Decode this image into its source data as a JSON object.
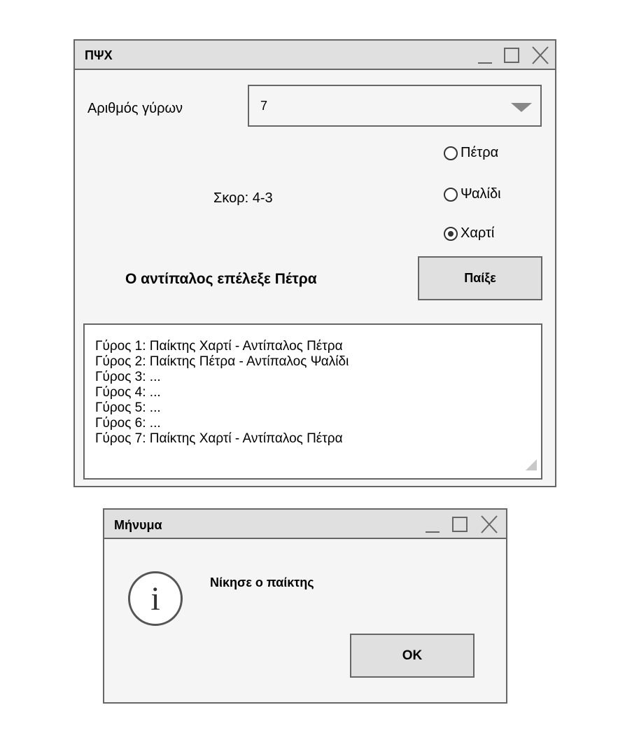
{
  "main_window": {
    "title": "ΠΨΧ",
    "rounds_label": "Αριθμός γύρων",
    "rounds_value": "7",
    "score_text": "Σκορ: 4-3",
    "radios": [
      {
        "label": "Πέτρα",
        "checked": false
      },
      {
        "label": "Ψαλίδι",
        "checked": false
      },
      {
        "label": "Χαρτί",
        "checked": true
      }
    ],
    "opponent_text": "Ο αντίπαλος επέλεξε Πέτρα",
    "play_label": "Παίξε",
    "log": [
      "Γύρος 1: Παίκτης Χαρτί - Αντίπαλος Πέτρα",
      "Γύρος 2: Παίκτης Πέτρα - Αντίπαλος Ψαλίδι",
      "Γύρος 3: ...",
      "Γύρος 4: ...",
      "Γύρος 5: ...",
      "Γύρος 6: ...",
      "Γύρος 7: Παίκτης Χαρτί - Αντίπαλος Πέτρα"
    ]
  },
  "message_window": {
    "title": "Μήνυμα",
    "icon": "info-icon",
    "message": "Νίκησε ο παίκτης",
    "ok_label": "OK"
  },
  "colors": {
    "titlebar": "#e0e0e0",
    "border": "#666666",
    "window_bg": "#f5f5f5",
    "button_bg": "#e0e0e0"
  }
}
